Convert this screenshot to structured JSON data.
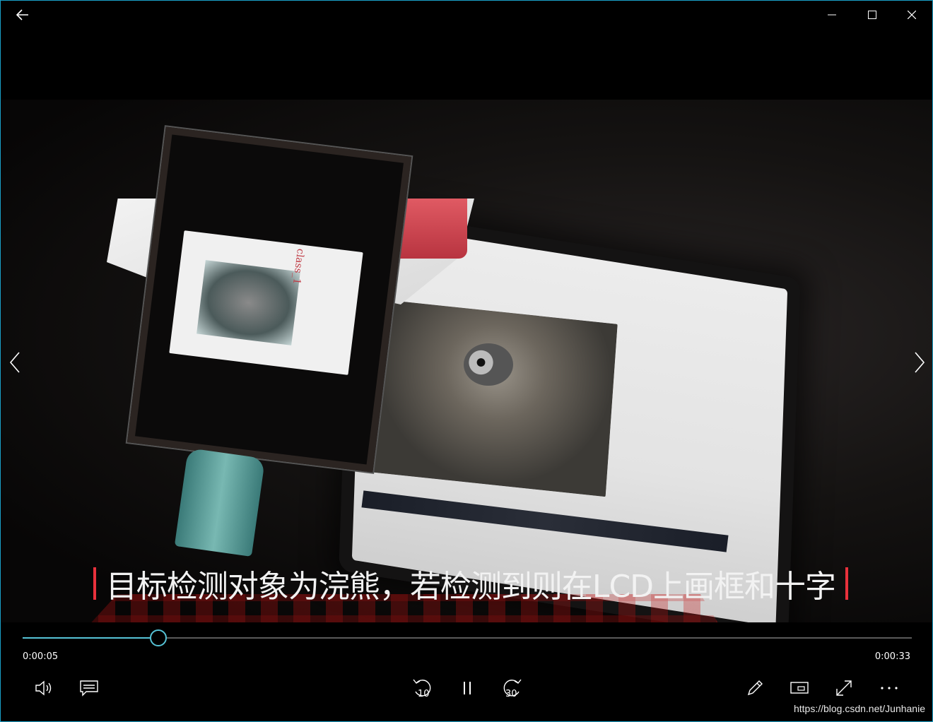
{
  "titlebar": {
    "back_icon": "back-arrow-icon",
    "minimize_icon": "minimize-icon",
    "maximize_icon": "maximize-icon",
    "close_icon": "close-icon"
  },
  "video": {
    "lcd_label": "class_1",
    "subtitle": "目标检测对象为浣熊，若检测到则在LCD上画框和十字"
  },
  "navigation": {
    "prev_icon": "chevron-left-icon",
    "next_icon": "chevron-right-icon"
  },
  "playback": {
    "current_time": "0:00:05",
    "total_time": "0:00:33",
    "progress": 0.152,
    "accent_color": "#56c3d6",
    "subtitle_bar_color": "#e8313c"
  },
  "controls": {
    "volume_icon": "volume-icon",
    "captions_icon": "captions-icon",
    "skip_back_label": "10",
    "skip_forward_label": "30",
    "pause_icon": "pause-icon",
    "edit_icon": "pencil-icon",
    "mini_view_icon": "mini-view-icon",
    "fullscreen_icon": "expand-icon",
    "more_icon": "more-icon"
  },
  "watermark": "https://blog.csdn.net/Junhanie"
}
